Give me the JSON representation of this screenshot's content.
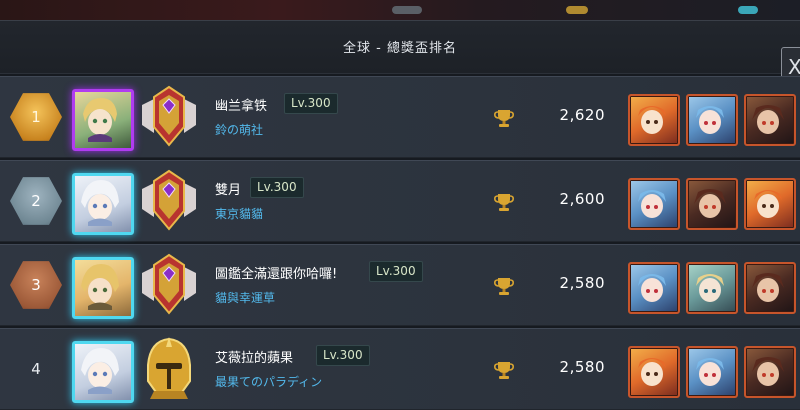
{
  "header": {
    "title": "全球 - 總獎盃排名",
    "close_label": "X"
  },
  "rows": [
    {
      "rank": "1",
      "rank_style": "gold",
      "name": "幽兰拿铁",
      "level": "Lv.300",
      "guild": "鈴の萌社",
      "score": "2,620",
      "avatar_frame": "purple",
      "emblem": "crest-purple-icon",
      "cards": [
        "fox",
        "blue",
        "dark"
      ]
    },
    {
      "rank": "2",
      "rank_style": "silver",
      "name": "雙月",
      "level": "Lv.300",
      "guild": "東京貓貓",
      "score": "2,600",
      "avatar_frame": "cyan",
      "emblem": "crest-purple-icon",
      "cards": [
        "blue",
        "dark",
        "fox"
      ]
    },
    {
      "rank": "3",
      "rank_style": "bronze",
      "name": "圖鑑全滿還跟你哈囉!",
      "level": "Lv.300",
      "guild": "貓與幸運草",
      "score": "2,580",
      "avatar_frame": "cyan",
      "emblem": "crest-purple-icon",
      "cards": [
        "blue",
        "elf",
        "dark"
      ]
    },
    {
      "rank": "4",
      "rank_style": "plain",
      "name": "艾薇拉的蘋果",
      "level": "Lv.300",
      "guild": "最果てのパラディン",
      "score": "2,580",
      "avatar_frame": "cyan",
      "emblem": "helmet-gold-icon",
      "cards": [
        "fox",
        "blue",
        "dark"
      ]
    }
  ],
  "colors": {
    "accent_cyan": "#53b9ec",
    "gold": "#d9a531",
    "row_bg": "#2f3641"
  }
}
